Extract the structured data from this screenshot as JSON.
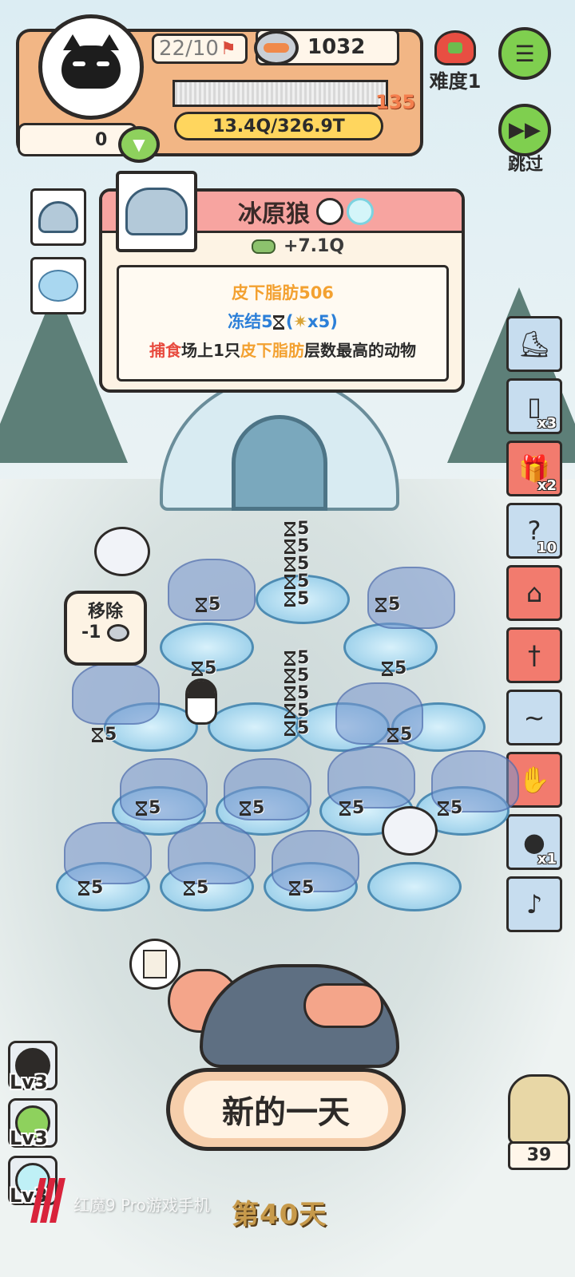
{
  "hud": {
    "hp_text": "22/10",
    "coins": "1032",
    "badge": "135",
    "score": "13.4Q/326.9T",
    "zero_value": "0",
    "difficulty_label": "难度1",
    "skip_label": "跳过"
  },
  "card": {
    "title": "冰原狼",
    "reward": "+7.1Q",
    "line1": "皮下脂肪506",
    "line2_a": "冻结5",
    "line2_b": "(",
    "line2_c": "x5)",
    "line3_a": "捕食",
    "line3_b": "场上1只",
    "line3_c": "皮下脂肪",
    "line3_d": "层数最高的动物"
  },
  "remove_bubble": {
    "title": "移除",
    "cost": "-1"
  },
  "items": [
    {
      "icon": "skate-icon",
      "count": ""
    },
    {
      "icon": "card-icon",
      "count": "x3"
    },
    {
      "icon": "gift-bag-icon",
      "count": "x2"
    },
    {
      "icon": "mystery-box-icon",
      "count": "10"
    },
    {
      "icon": "lantern-icon",
      "count": ""
    },
    {
      "icon": "sword-icon",
      "count": ""
    },
    {
      "icon": "feather-icon",
      "count": ""
    },
    {
      "icon": "mittens-icon",
      "count": ""
    },
    {
      "icon": "hockey-icon",
      "count": "x1"
    },
    {
      "icon": "bell-icon",
      "count": ""
    }
  ],
  "board": {
    "timer_value": "5"
  },
  "levels": [
    "Lv3",
    "Lv3",
    "Lv3"
  ],
  "new_day_button": "新的一天",
  "day_label": "第40天",
  "watermark": "红魔9 Pro游戏手机",
  "owl_count": "39",
  "colors": {
    "hud_orange": "#f2b685",
    "score_yellow": "#ffd65e",
    "card_header": "#f7a4a0",
    "accent_green": "#7fcf4f",
    "text_orange": "#f3a131",
    "text_blue": "#2b7fd8",
    "text_red": "#e84b3f"
  }
}
